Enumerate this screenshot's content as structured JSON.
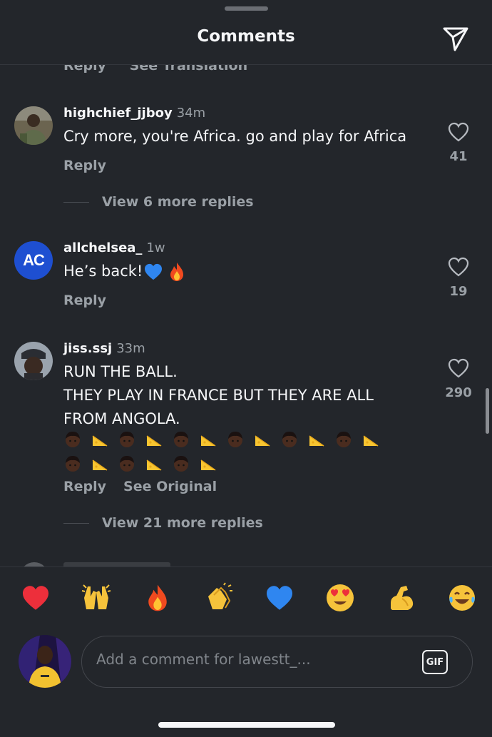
{
  "header": {
    "title": "Comments",
    "send_icon": "paper-plane-icon"
  },
  "cut_row": {
    "reply": "Reply",
    "translation": "See Translation"
  },
  "comments": [
    {
      "username": "highchief_jjboy",
      "time": "34m",
      "text": "Cry more, you're Africa. go and play for Africa",
      "reply": "Reply",
      "likes": "41",
      "view_replies": "View 6 more replies"
    },
    {
      "username": "allchelsea_",
      "time": "1w",
      "text": "He’s back!",
      "avatar_initials": "AC",
      "reply": "Reply",
      "likes": "19"
    },
    {
      "username": "jiss.ssj",
      "time": "33m",
      "line1": "RUN THE BALL.",
      "line2": "THEY PLAY IN FRANCE BUT THEY ARE ALL FROM ANGOLA.",
      "emoji_sequence": [
        "boy-dark-icon",
        "cheese-icon",
        "boy-dark-icon",
        "cheese-icon",
        "boy-dark-icon",
        "cheese-icon",
        "boy-dark-icon",
        "cheese-icon",
        "boy-dark-icon",
        "cheese-icon",
        "boy-dark-icon",
        "cheese-icon",
        "boy-dark-icon",
        "cheese-icon",
        "boy-dark-icon",
        "cheese-icon",
        "boy-dark-icon",
        "cheese-icon"
      ],
      "reply": "Reply",
      "see_original": "See Original",
      "likes": "290",
      "view_replies": "View 21 more replies"
    }
  ],
  "reactions": [
    "red-heart-icon",
    "raising-hands-icon",
    "fire-icon",
    "clapping-hands-icon",
    "blue-heart-icon",
    "heart-eyes-icon",
    "flexed-biceps-icon",
    "tears-of-joy-icon"
  ],
  "composer": {
    "placeholder": "Add a comment for lawestt_...",
    "gif_label": "GIF"
  },
  "colors": {
    "background": "#23262b",
    "text": "#f5f6f8",
    "muted": "#9aa0a6",
    "accent_blue": "#1e4fd1"
  }
}
